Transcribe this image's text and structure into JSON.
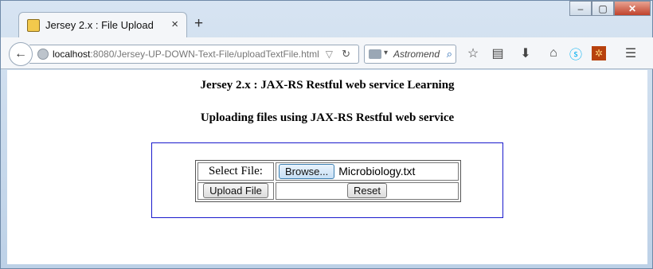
{
  "tab": {
    "title": "Jersey 2.x : File Upload",
    "close": "×"
  },
  "new_tab": "+",
  "window_controls": {
    "minimize": "–",
    "maximize": "▢",
    "close": "✕"
  },
  "url": {
    "host": "localhost",
    "rest": ":8080/Jersey-UP-DOWN-Text-File/uploadTextFile.html"
  },
  "search": {
    "placeholder": "Astromend"
  },
  "toolbar_icons": [
    "bookmark-star-icon",
    "reading-list-icon",
    "download-icon",
    "home-icon",
    "skype-icon",
    "addon-icon",
    "menu-icon"
  ],
  "page": {
    "heading1": "Jersey 2.x : JAX-RS Restful web service Learning",
    "heading2": "Uploading files using JAX-RS Restful web service",
    "select_label": "Select File:",
    "browse_label": "Browse...",
    "file_name": "Microbiology.txt",
    "upload_label": "Upload File",
    "reset_label": "Reset"
  },
  "colors": {
    "box_border": "#1a1acc",
    "skype": "#00aff0",
    "addon": "#b7410e"
  }
}
